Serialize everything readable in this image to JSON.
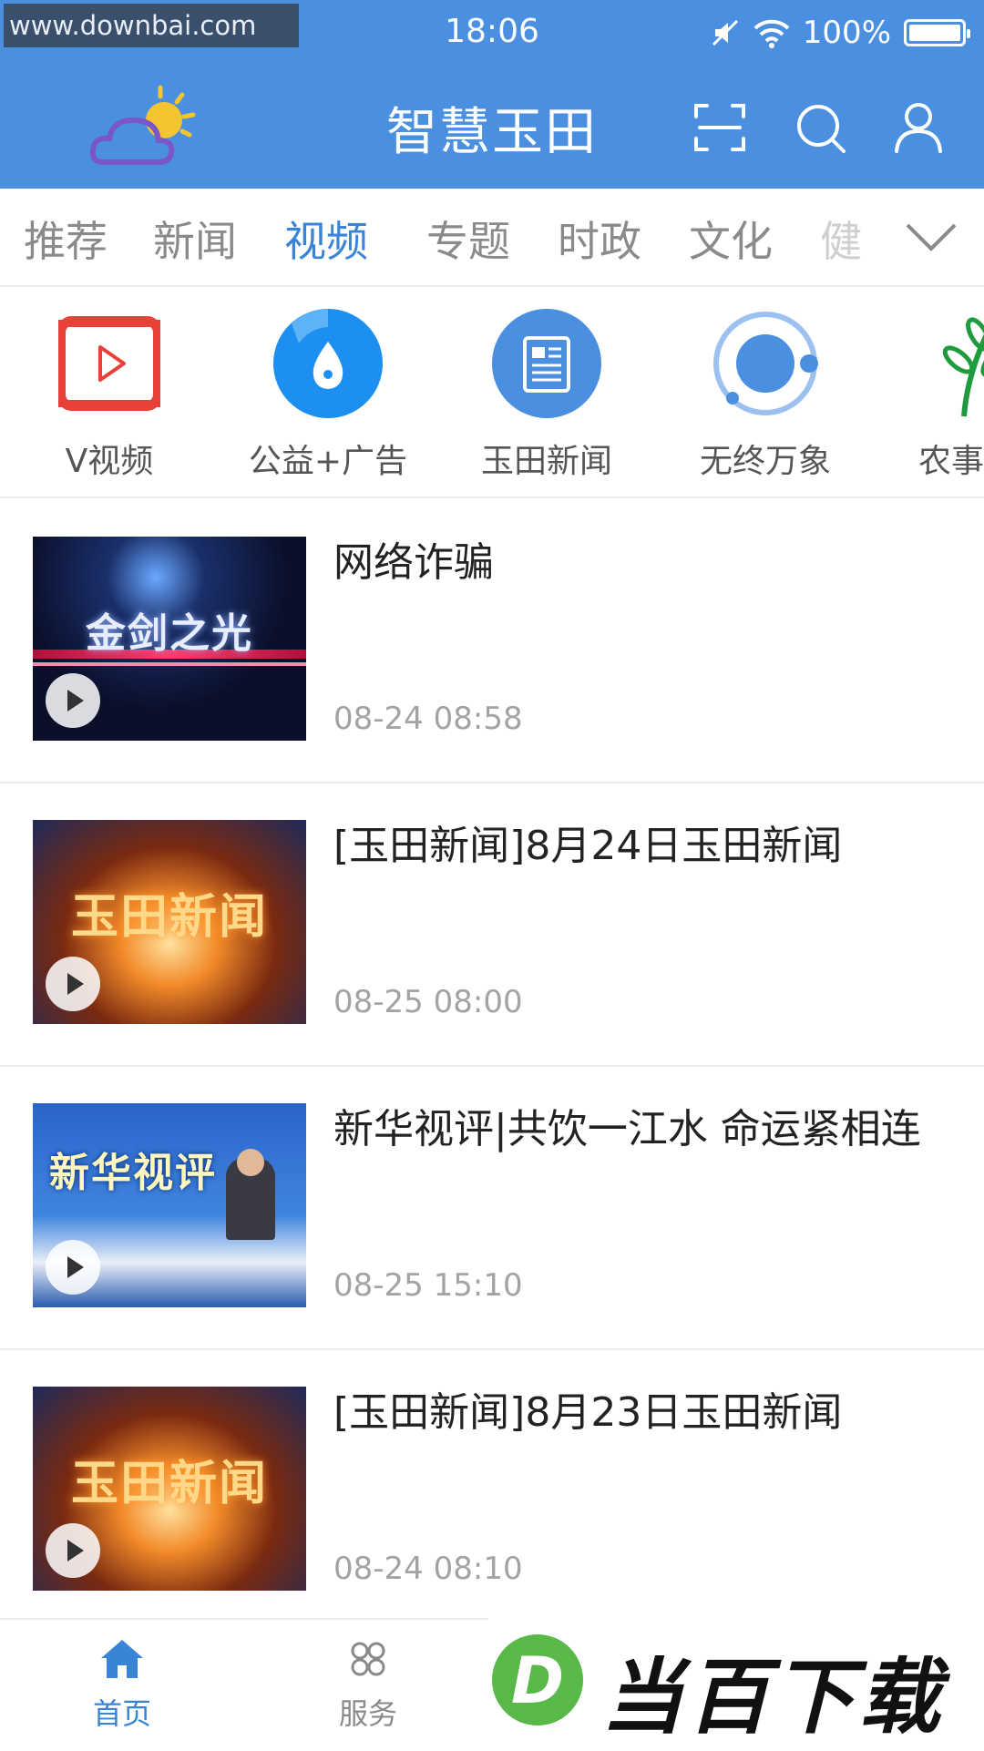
{
  "status": {
    "watermark": "www.downbai.com",
    "time": "18:06",
    "battery": "100%"
  },
  "header": {
    "title": "智慧玉田",
    "icons": [
      "weather-logo-icon",
      "scan-icon",
      "search-icon",
      "user-icon"
    ]
  },
  "tabs": [
    {
      "label": "推荐"
    },
    {
      "label": "新闻"
    },
    {
      "label": "视频",
      "active": true
    },
    {
      "label": "专题"
    },
    {
      "label": "时政"
    },
    {
      "label": "文化"
    },
    {
      "label": "健"
    }
  ],
  "categories": [
    {
      "label": "V视频",
      "icon": "video-play-icon"
    },
    {
      "label": "公益+广告",
      "icon": "water-drop-icon"
    },
    {
      "label": "玉田新闻",
      "icon": "newspaper-icon"
    },
    {
      "label": "无终万象",
      "icon": "orbit-icon"
    },
    {
      "label": "农事",
      "icon": "sprout-icon"
    }
  ],
  "videos": [
    {
      "title": "网络诈骗",
      "date": "08-24 08:58",
      "thumb_caption": "金剑之光"
    },
    {
      "title": "[玉田新闻]8月24日玉田新闻",
      "date": "08-25 08:00",
      "thumb_caption": "玉田新闻"
    },
    {
      "title": "新华视评|共饮一江水 命运紧相连",
      "date": "08-25 15:10",
      "thumb_caption": "新华视评"
    },
    {
      "title": "[玉田新闻]8月23日玉田新闻",
      "date": "08-24 08:10",
      "thumb_caption": "玉田新闻"
    }
  ],
  "bottom_nav": [
    {
      "label": "首页",
      "icon": "home-icon",
      "active": true
    },
    {
      "label": "服务",
      "icon": "services-icon"
    }
  ],
  "brand_watermark": "当百下载",
  "colors": {
    "primary": "#4a8fe0",
    "active_tab": "#3a84d8",
    "nav_active": "#3a84d8"
  }
}
